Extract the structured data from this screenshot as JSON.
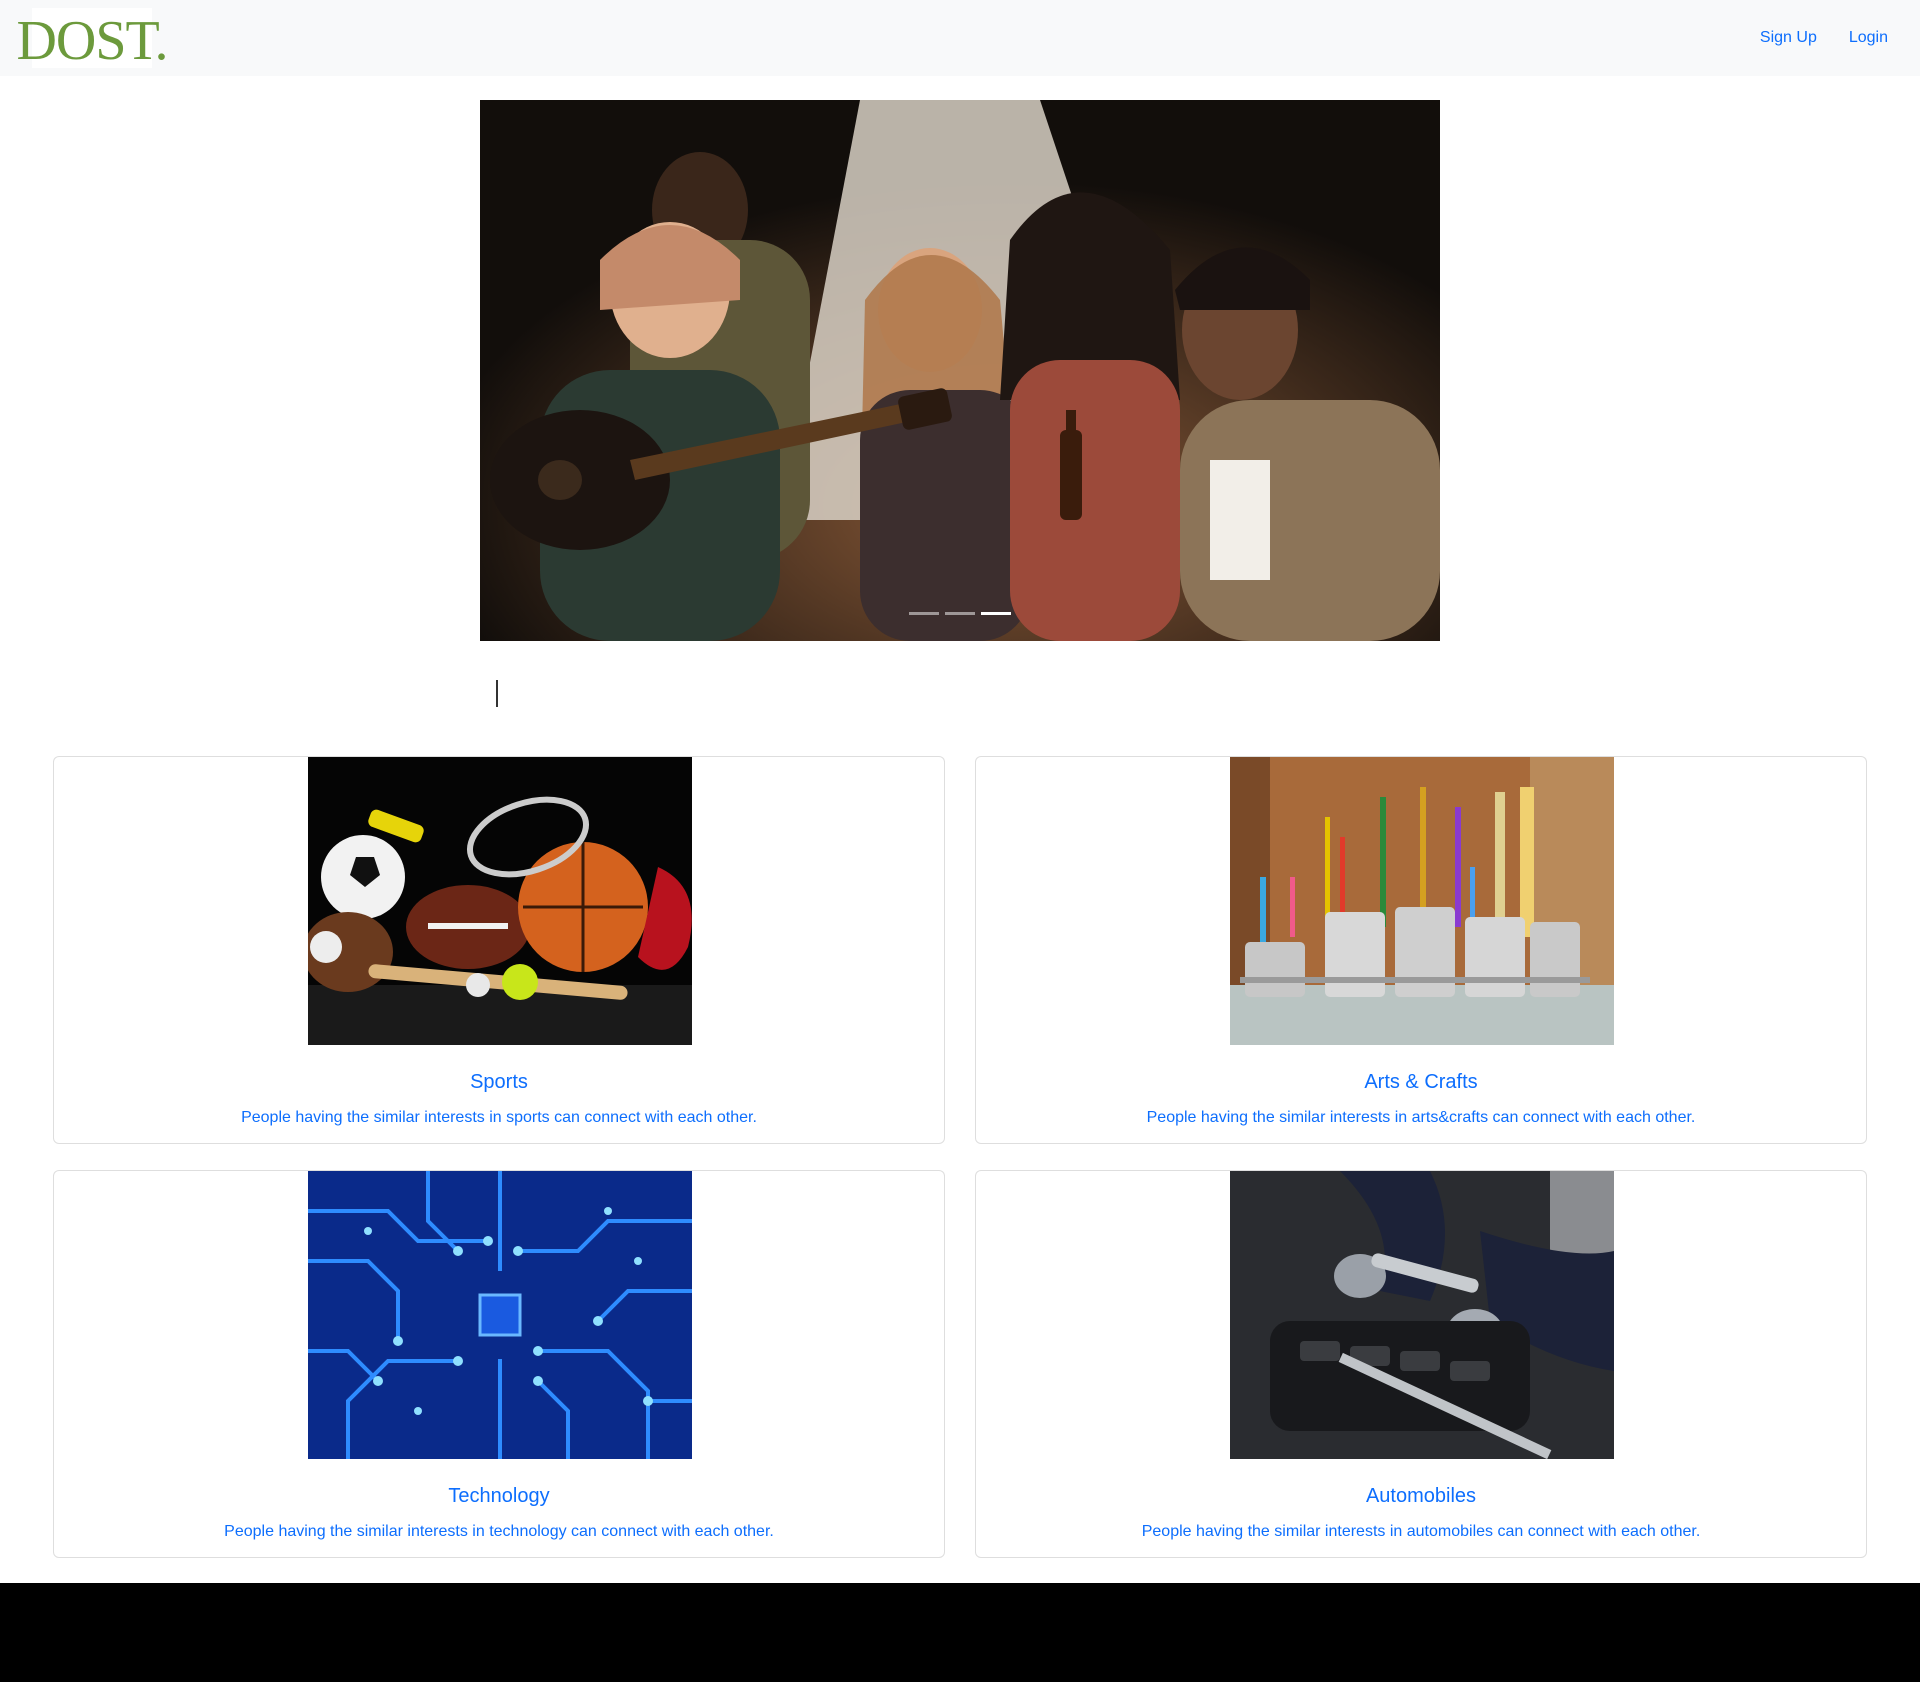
{
  "header": {
    "brand": "DOST.",
    "nav": [
      {
        "label": "Sign Up"
      },
      {
        "label": "Login"
      }
    ]
  },
  "carousel": {
    "slide_count": 3,
    "active_index": 2,
    "image": "friends-campfire-guitar-photo"
  },
  "categories": [
    {
      "title": "Sports",
      "description": "People having the similar interests in sports can connect with each other.",
      "image": "sports-equipment-photo"
    },
    {
      "title": "Arts & Crafts",
      "description": "People having the similar interests in arts&crafts can connect with each other.",
      "image": "art-supplies-photo"
    },
    {
      "title": "Technology",
      "description": "People having the similar interests in technology can connect with each other.",
      "image": "circuit-board-photo"
    },
    {
      "title": "Automobiles",
      "description": "People having the similar interests in automobiles can connect with each other.",
      "image": "car-engine-mechanic-photo"
    }
  ],
  "colors": {
    "brand": "#6c9a3c",
    "link": "#0d6efd",
    "navbar_bg": "#f8f9fa",
    "footer_bg": "#000000"
  }
}
